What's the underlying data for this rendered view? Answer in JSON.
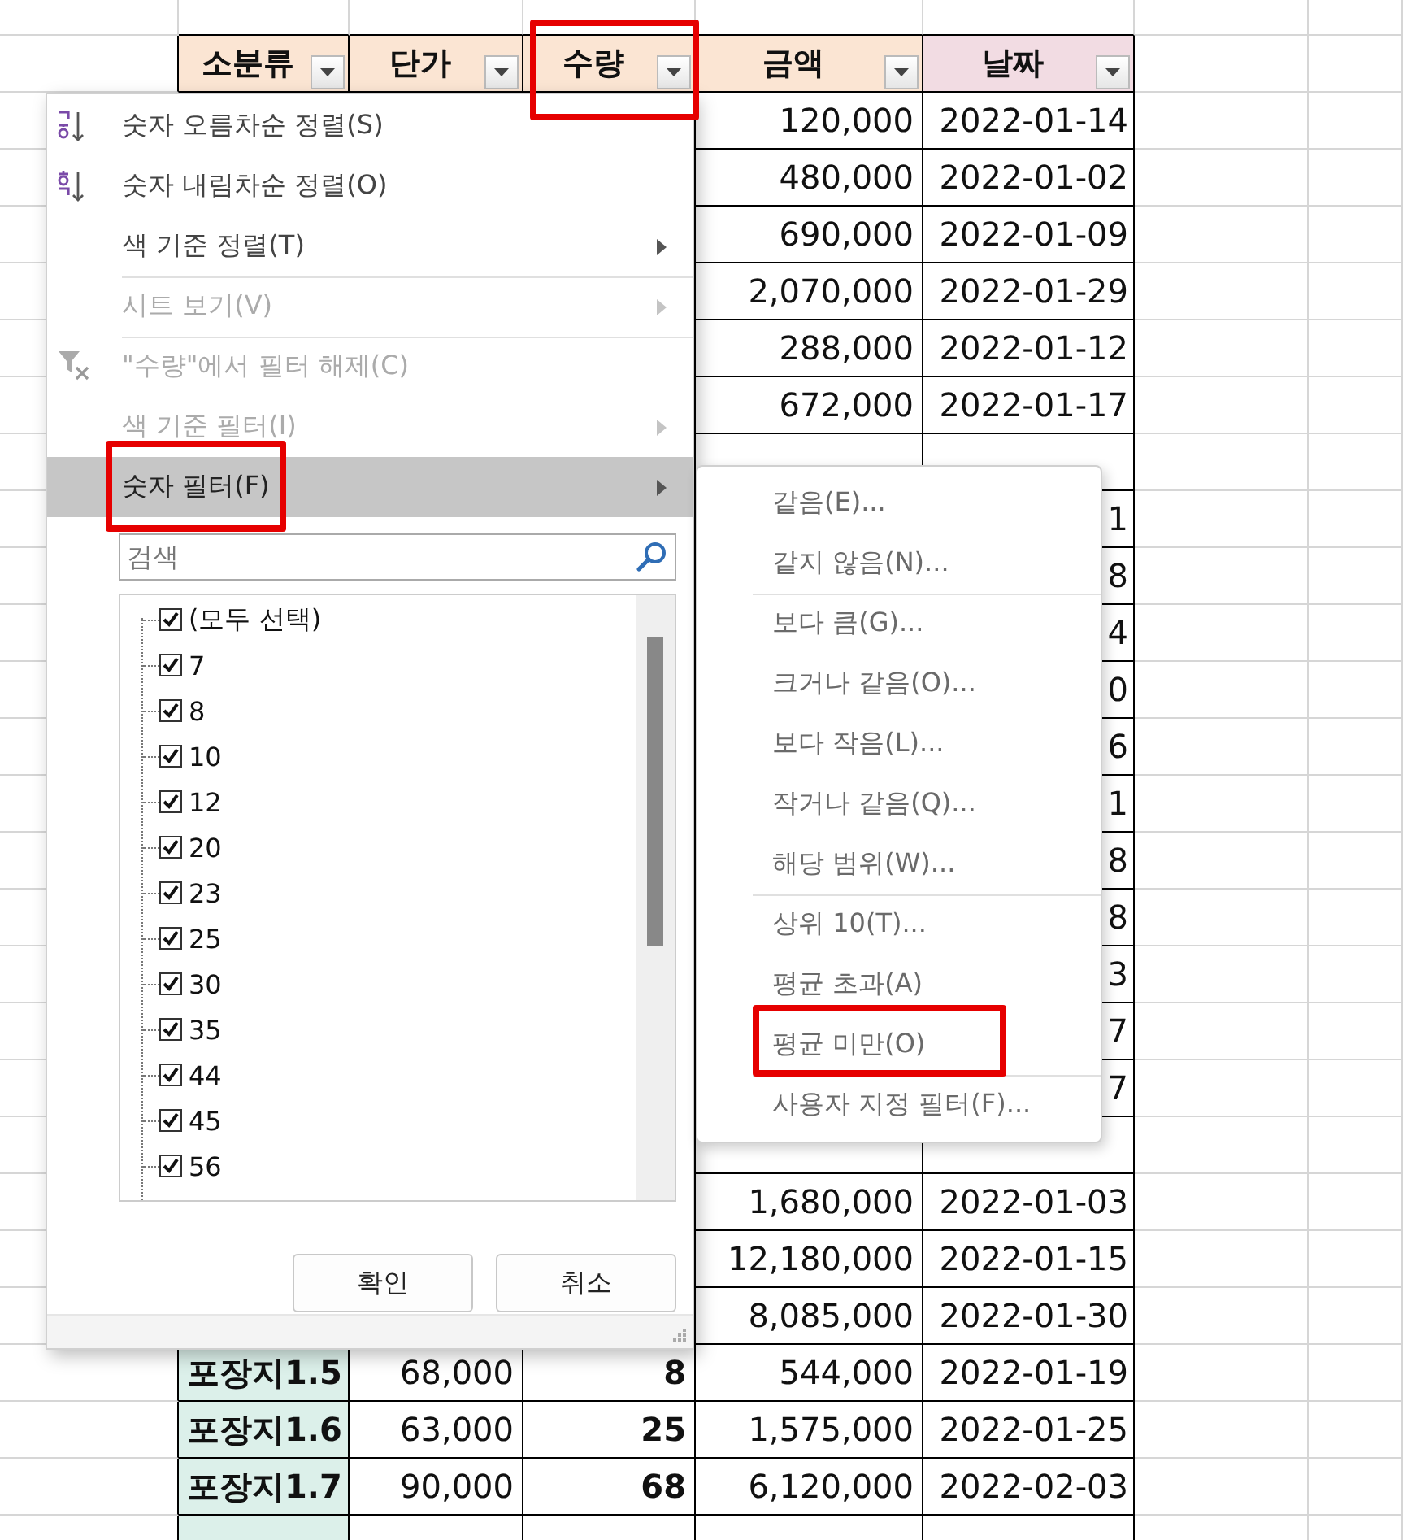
{
  "sheet": {
    "columns": [
      {
        "title": "소분류",
        "color": "#fbe5d3",
        "annotated": false
      },
      {
        "title": "단가",
        "color": "#fbe5d3",
        "annotated": false
      },
      {
        "title": "수량",
        "color": "#fbe5d3",
        "annotated": true
      },
      {
        "title": "금액",
        "color": "#fbe5d3",
        "annotated": false
      },
      {
        "title": "날짜",
        "color": "#f2dce3",
        "annotated": false
      }
    ],
    "rows": [
      {
        "amount": "120,000",
        "date": "2022-01-14"
      },
      {
        "amount": "480,000",
        "date": "2022-01-02"
      },
      {
        "amount": "690,000",
        "date": "2022-01-09"
      },
      {
        "amount": "2,070,000",
        "date": "2022-01-29"
      },
      {
        "amount": "288,000",
        "date": "2022-01-12"
      },
      {
        "amount": "672,000",
        "date": "2022-01-17"
      },
      {},
      {
        "date": "1"
      },
      {
        "date": "8"
      },
      {
        "date": "4"
      },
      {
        "date": "0"
      },
      {
        "date": "6"
      },
      {
        "date": "1"
      },
      {
        "date": "8"
      },
      {
        "date": "8"
      },
      {
        "date": "3"
      },
      {
        "date": "7"
      },
      {
        "date": "7"
      },
      {},
      {
        "amount": "1,680,000",
        "date": "2022-01-03"
      },
      {
        "amount": "12,180,000",
        "date": "2022-01-15"
      },
      {
        "amount": "8,085,000",
        "date": "2022-01-30"
      },
      {
        "item": "포장지1.5",
        "price": "68,000",
        "qty": "8",
        "amount": "544,000",
        "date": "2022-01-19"
      },
      {
        "item": "포장지1.6",
        "price": "63,000",
        "qty": "25",
        "amount": "1,575,000",
        "date": "2022-01-25"
      },
      {
        "item": "포장지1.7",
        "price": "90,000",
        "qty": "68",
        "amount": "6,120,000",
        "date": "2022-02-03"
      }
    ]
  },
  "filter_menu": {
    "items": [
      {
        "label": "숫자 오름차순 정렬(S)",
        "kind": "sort-ascending",
        "disabled": false,
        "selected": false,
        "submenu": false,
        "separator_before": false,
        "annotated": false
      },
      {
        "label": "숫자 내림차순 정렬(O)",
        "kind": "sort-descending",
        "disabled": false,
        "selected": false,
        "submenu": false,
        "separator_before": false,
        "annotated": false
      },
      {
        "label": "색 기준 정렬(T)",
        "kind": "plain",
        "disabled": false,
        "selected": false,
        "submenu": true,
        "separator_before": false,
        "annotated": false
      },
      {
        "label": "시트 보기(V)",
        "kind": "plain",
        "disabled": true,
        "selected": false,
        "submenu": true,
        "separator_before": true,
        "annotated": false
      },
      {
        "label": "\"수량\"에서 필터 해제(C)",
        "kind": "filter-clear",
        "disabled": true,
        "selected": false,
        "submenu": false,
        "separator_before": true,
        "annotated": false
      },
      {
        "label": "색 기준 필터(I)",
        "kind": "plain",
        "disabled": true,
        "selected": false,
        "submenu": true,
        "separator_before": false,
        "annotated": false
      },
      {
        "label": "숫자 필터(F)",
        "kind": "plain",
        "disabled": false,
        "selected": true,
        "submenu": true,
        "separator_before": false,
        "annotated": true
      }
    ],
    "search": {
      "placeholder": "검색"
    },
    "values": [
      {
        "label": "(모두 선택)",
        "checked": true
      },
      {
        "label": "7",
        "checked": true
      },
      {
        "label": "8",
        "checked": true
      },
      {
        "label": "10",
        "checked": true
      },
      {
        "label": "12",
        "checked": true
      },
      {
        "label": "20",
        "checked": true
      },
      {
        "label": "23",
        "checked": true
      },
      {
        "label": "25",
        "checked": true
      },
      {
        "label": "30",
        "checked": true
      },
      {
        "label": "35",
        "checked": true
      },
      {
        "label": "44",
        "checked": true
      },
      {
        "label": "45",
        "checked": true
      },
      {
        "label": "56",
        "checked": true
      }
    ],
    "buttons": [
      "확인",
      "취소"
    ]
  },
  "submenu": {
    "items": [
      {
        "label": "같음(E)...",
        "separator_before": false,
        "annotated": false
      },
      {
        "label": "같지 않음(N)...",
        "separator_before": false,
        "annotated": false
      },
      {
        "label": "보다 큼(G)...",
        "separator_before": true,
        "annotated": false
      },
      {
        "label": "크거나 같음(O)...",
        "separator_before": false,
        "annotated": false
      },
      {
        "label": "보다 작음(L)...",
        "separator_before": false,
        "annotated": false
      },
      {
        "label": "작거나 같음(Q)...",
        "separator_before": false,
        "annotated": false
      },
      {
        "label": "해당 범위(W)...",
        "separator_before": false,
        "annotated": false
      },
      {
        "label": "상위 10(T)...",
        "separator_before": true,
        "annotated": false
      },
      {
        "label": "평균 초과(A)",
        "separator_before": false,
        "annotated": false
      },
      {
        "label": "평균 미만(O)",
        "separator_before": false,
        "annotated": true
      },
      {
        "label": "사용자 지정 필터(F)...",
        "separator_before": true,
        "annotated": false
      }
    ]
  }
}
